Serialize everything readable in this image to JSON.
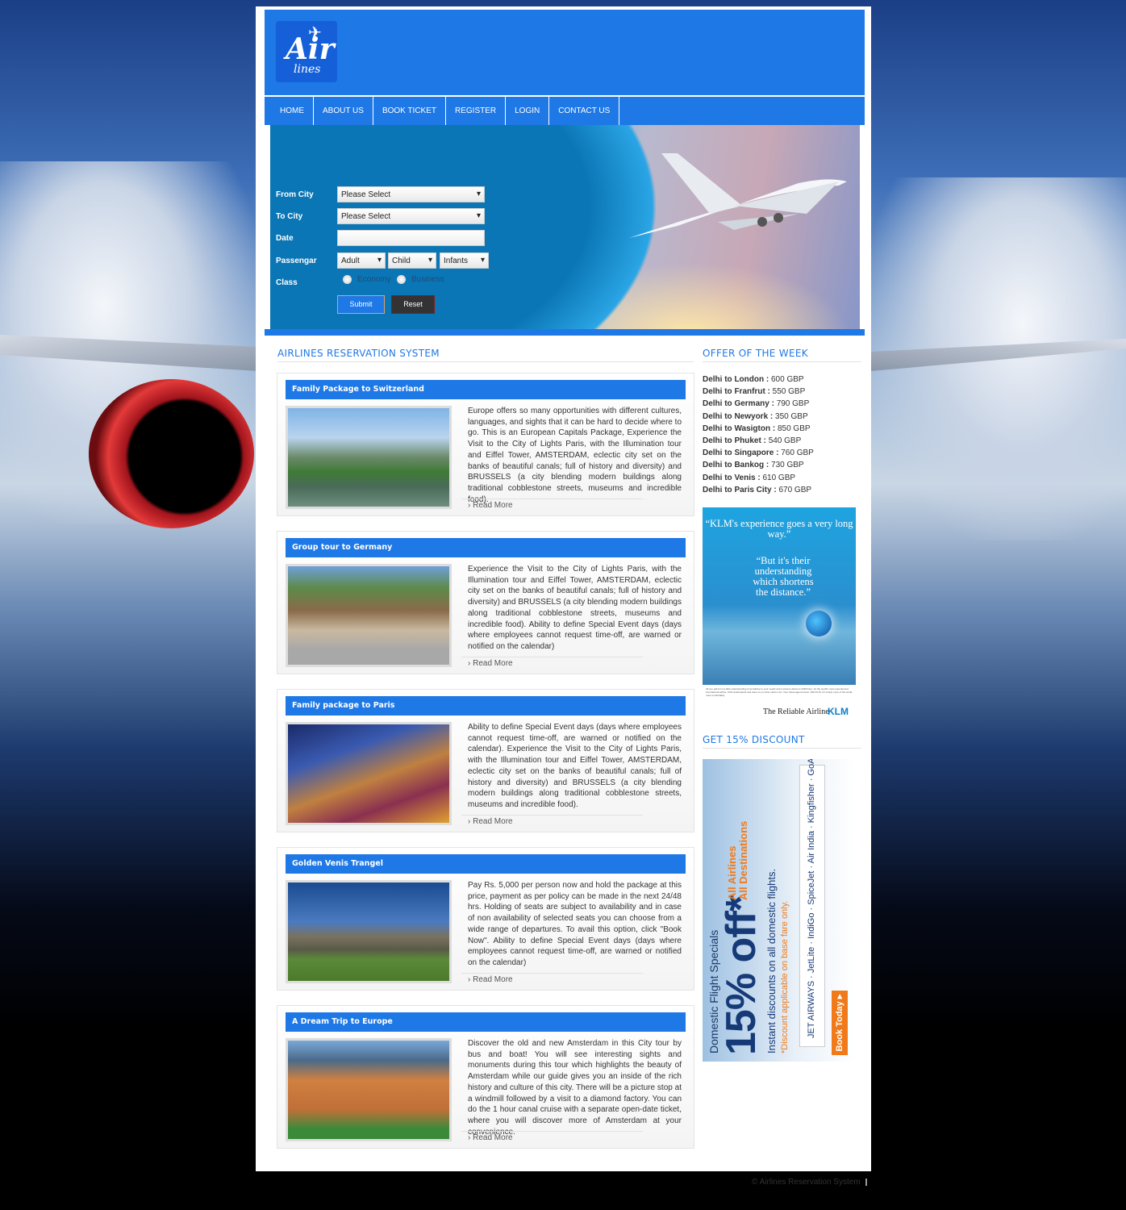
{
  "logo": {
    "text_main": "Air",
    "text_sub": "lines"
  },
  "nav": [
    "HOME",
    "ABOUT US",
    "BOOK TICKET",
    "REGISTER",
    "LOGIN",
    "CONTACT US"
  ],
  "form": {
    "from_label": "From City",
    "from_value": "Please Select",
    "to_label": "To City",
    "to_value": "Please Select",
    "date_label": "Date",
    "date_value": "",
    "passenger_label": "Passengar",
    "adult": "Adult",
    "child": "Child",
    "infants": "Infants",
    "class_label": "Class",
    "economy": "Economy",
    "business": "Business",
    "submit": "Submit",
    "reset": "Reset"
  },
  "main_heading": "AIRLINES RESERVATION SYSTEM",
  "articles": [
    {
      "title": "Family Package to Switzerland",
      "text": "Europe offers so many opportunities with different cultures, languages, and sights that it can be hard to decide where to go. This is an European Capitals Package, Experience the Visit to the City of Lights Paris, with the Illumination tour and Eiffel Tower, AMSTERDAM, eclectic city set on the banks of beautiful canals; full of history and diversity) and BRUSSELS (a city blending modern buildings along traditional cobblestone streets, museums and incredible food).",
      "read_more": "Read More"
    },
    {
      "title": "Group tour to Germany",
      "text": "Experience the Visit to the City of Lights Paris, with the Illumination tour and Eiffel Tower, AMSTERDAM, eclectic city set on the banks of beautiful canals; full of history and diversity) and BRUSSELS (a city blending modern buildings along traditional cobblestone streets, museums and incredible food). Ability to define Special Event days (days where employees cannot request time-off, are warned or notified on the calendar)",
      "read_more": "Read More"
    },
    {
      "title": "Family package to Paris",
      "text": "Ability to define Special Event days (days where employees cannot request time-off, are warned or notified on the calendar). Experience the Visit to the City of Lights Paris, with the Illumination tour and Eiffel Tower, AMSTERDAM, eclectic city set on the banks of beautiful canals; full of history and diversity) and BRUSSELS (a city blending modern buildings along traditional cobblestone streets, museums and incredible food).",
      "read_more": "Read More"
    },
    {
      "title": "Golden Venis Trangel",
      "text": "Pay Rs. 5,000 per person now and hold the package at this price, payment as per policy can be made in the next 24/48 hrs. Holding of seats are subject to availability and in case of non availability of selected seats you can choose from a wide range of departures. To avail this option, click \"Book Now\". Ability to define Special Event days (days where employees cannot request time-off, are warned or notified on the calendar)",
      "read_more": "Read More"
    },
    {
      "title": "A Dream Trip to Europe",
      "text": "Discover the old and new Amsterdam in this City tour by bus and boat! You will see interesting sights and monuments during this tour which highlights the beauty of Amsterdam while our guide gives you an inside of the rich history and culture of this city. There will be a picture stop at a windmill followed by a visit to a diamond factory. You can do the 1 hour canal cruise with a separate open-date ticket, where you will discover more of Amsterdam at your convenience.",
      "read_more": "Read More"
    }
  ],
  "offer_heading": "OFFER OF THE WEEK",
  "offers": [
    {
      "route": "Delhi to London :",
      "price": "600 GBP"
    },
    {
      "route": "Delhi to Franfrut :",
      "price": "550 GBP"
    },
    {
      "route": "Delhi to Germany :",
      "price": "790 GBP"
    },
    {
      "route": "Delhi to Newyork :",
      "price": "350 GBP"
    },
    {
      "route": "Delhi to Wasigton :",
      "price": "850 GBP"
    },
    {
      "route": "Delhi to Phuket :",
      "price": "540 GBP"
    },
    {
      "route": "Delhi to Singapore :",
      "price": "760 GBP"
    },
    {
      "route": "Delhi to Bankog :",
      "price": "730 GBP"
    },
    {
      "route": "Delhi to Venis :",
      "price": "610 GBP"
    },
    {
      "route": "Delhi to Paris City :",
      "price": "670 GBP"
    }
  ],
  "klm_ad": {
    "quote1": "“KLM's experience goes a very long way.”",
    "quote2": "“But it's their understanding which shortens the distance.”",
    "fine_print": "All you ask for is a little understanding of sensitivity to your needs and a sincere desire to fulfill them. As the world's most experienced international airline, KLM understands and does so no other carrier can. Your travel agent knows. With KLM, it's simply more of the world, more comfortably.",
    "tagline": "The Reliable Airline",
    "brand": "KLM"
  },
  "discount_heading": "GET 15% DISCOUNT",
  "discount_ad": {
    "line1": "Domestic Flight Specials",
    "big": "15% off*",
    "orange1": "All Airlines",
    "orange2": "All Destinations",
    "line3": "Instant discounts on all domestic flights.",
    "line4": "*Discount applicable on base fare only.",
    "airlines": "JET AIRWAYS · JetLite · IndiGo · SpiceJet · Air India · Kingfisher · GoAir",
    "cta": "Book Today ▸"
  },
  "footer": "© Airlines Reservation System",
  "colors": {
    "brand_blue": "#1e78e6",
    "reset_dark": "#333333",
    "discount_orange": "#f07a1a"
  }
}
